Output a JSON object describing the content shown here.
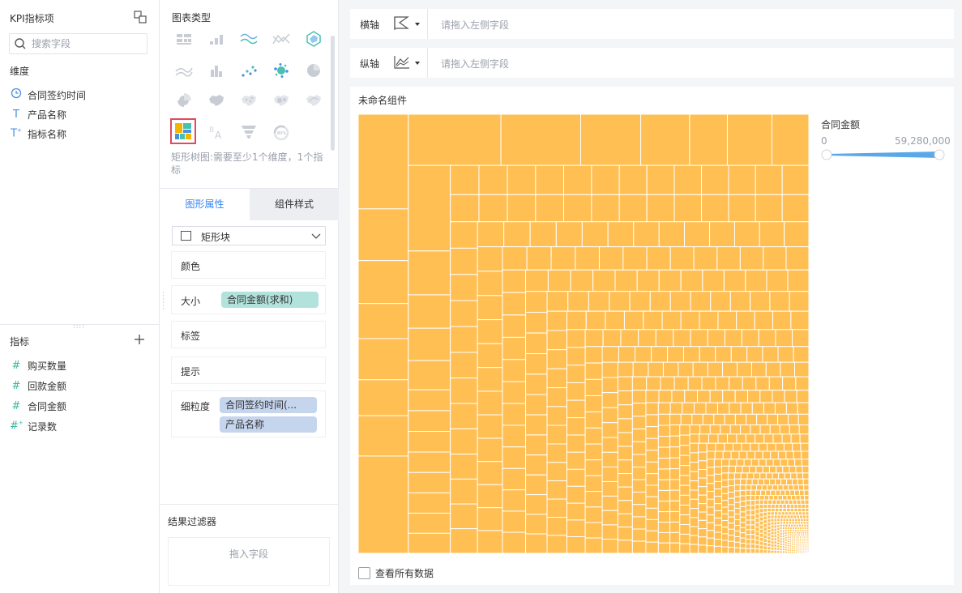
{
  "fields_panel": {
    "title": "KPI指标项",
    "search_placeholder": "搜索字段",
    "dimensions_title": "维度",
    "dimensions": [
      {
        "label": "合同签约时间",
        "icon": "clock-icon"
      },
      {
        "label": "产品名称",
        "icon": "text-type-icon"
      },
      {
        "label": "指标名称",
        "icon": "text-type-custom-icon"
      }
    ],
    "measures_title": "指标",
    "measures": [
      {
        "label": "购买数量",
        "icon": "hash-icon"
      },
      {
        "label": "回款金额",
        "icon": "hash-icon"
      },
      {
        "label": "合同金额",
        "icon": "hash-icon"
      },
      {
        "label": "记录数",
        "icon": "hash-custom-icon"
      }
    ]
  },
  "config_panel": {
    "chart_types_title": "图表类型",
    "chart_types": [
      "grouped-table-icon",
      "bar-chart-icon",
      "line-chart-icon",
      "stacked-line-icon",
      "radar-chart-icon",
      "area-chart-icon",
      "column-chart-icon",
      "scatter-chart-icon",
      "bubble-chart-icon",
      "pie-chart-icon",
      "rose-chart-icon",
      "region-map-icon",
      "point-map-icon",
      "heat-map-icon",
      "flow-map-icon",
      "treemap-icon",
      "word-cloud-icon",
      "funnel-chart-icon",
      "gauge-chart-icon"
    ],
    "selected_chart_type": "treemap-icon",
    "chart_hint": "矩形树图:需要至少1个维度，1个指标",
    "tabs": {
      "active": "图形属性",
      "inactive": "组件样式"
    },
    "shape_select_value": "矩形块",
    "props": {
      "color": "颜色",
      "size": "大小",
      "size_field": "合同金额(求和)",
      "label": "标签",
      "tooltip": "提示",
      "granularity": "细粒度",
      "granularity_fields": [
        "合同签约时间(...",
        "产品名称"
      ]
    },
    "filter_title": "结果过滤器",
    "filter_drop_hint": "拖入字段"
  },
  "axes": {
    "x_label": "横轴",
    "x_placeholder": "请拖入左侧字段",
    "y_label": "纵轴",
    "y_placeholder": "请拖入左侧字段"
  },
  "canvas": {
    "component_title": "未命名组件",
    "legend_title": "合同金额",
    "legend_min": "0",
    "legend_max": "59,280,000",
    "show_all_data": "查看所有数据",
    "fill_color": "#ffbf53",
    "accent_color": "#3685f2",
    "legend_color": "#5ba8e8"
  },
  "chart_data": {
    "type": "treemap",
    "title": "未命名组件",
    "size_measure": "合同金额(求和)",
    "color_legend": {
      "title": "合同金额",
      "min": 0,
      "max": 59280000
    },
    "top_rectangle_relative_sizes": [
      10.8,
      5.9,
      4.9,
      4.0,
      4.7,
      4.1,
      4.6,
      11.1,
      10.8,
      9.3,
      7.0,
      5.7,
      4.4,
      5.2,
      4.3,
      8.2,
      4.2,
      3.2,
      3.1,
      2.8,
      2.0
    ],
    "approximate_total_rectangles": 1000
  }
}
